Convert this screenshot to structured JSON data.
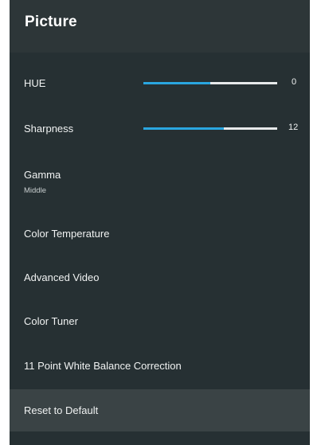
{
  "header": {
    "title": "Picture"
  },
  "menu": {
    "hue": {
      "label": "HUE",
      "value": "0",
      "level": 0.5
    },
    "sharpness": {
      "label": "Sharpness",
      "value": "12",
      "level": 0.6
    },
    "gamma": {
      "label": "Gamma",
      "sublabel": "Middle"
    },
    "color_temperature": {
      "label": "Color Temperature"
    },
    "advanced_video": {
      "label": "Advanced Video"
    },
    "color_tuner": {
      "label": "Color Tuner"
    },
    "white_balance": {
      "label": "11 Point White Balance Correction"
    },
    "reset": {
      "label": "Reset to Default"
    }
  },
  "colors": {
    "panel_bg": "#263033",
    "header_bg": "#2d3638",
    "selected_bg": "#3a4345",
    "slider_fill": "#2aa6e0",
    "slider_track": "#e6e9ea"
  }
}
